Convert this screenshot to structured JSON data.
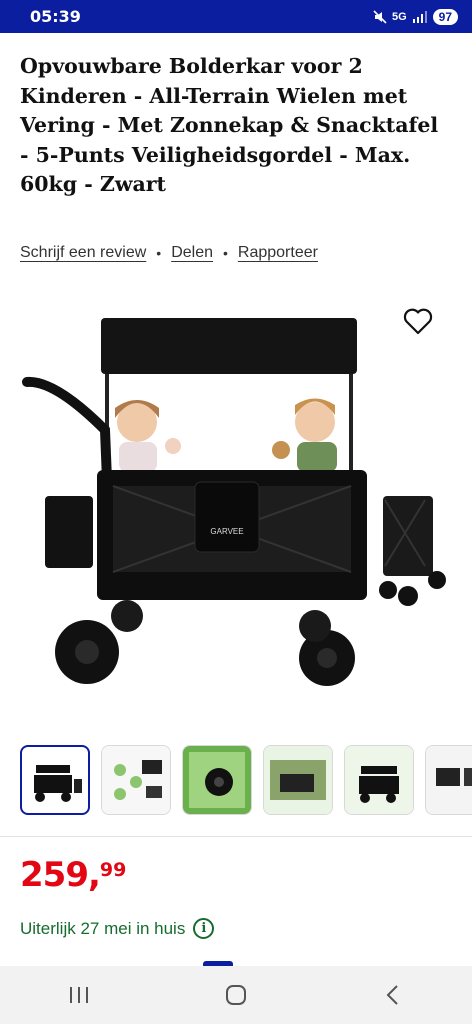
{
  "status_bar": {
    "time": "05:39",
    "network": "5G",
    "battery": "97"
  },
  "product": {
    "title": "Opvouwbare Bolderkar voor 2 Kinderen - All-Terrain Wielen met Vering - Met Zonnekap & Snacktafel - 5-Punts Veiligheidsgordel - Max. 60kg - Zwart",
    "brand_on_bag": "GARVEE"
  },
  "actions": {
    "review": "Schrijf een review",
    "share": "Delen",
    "report": "Rapporteer",
    "separator": "•"
  },
  "icons": {
    "favorite": "heart-outline-icon",
    "info": "info-icon"
  },
  "thumbnails_count": 6,
  "price": {
    "whole": "259,",
    "cents": "99",
    "color": "#e30613"
  },
  "delivery": {
    "text": "Uiterlijk 27 mei in huis",
    "color": "#166c2e"
  },
  "colors": {
    "status_bar": "#0b1ea0",
    "nav_bar": "#f2f2f2"
  }
}
